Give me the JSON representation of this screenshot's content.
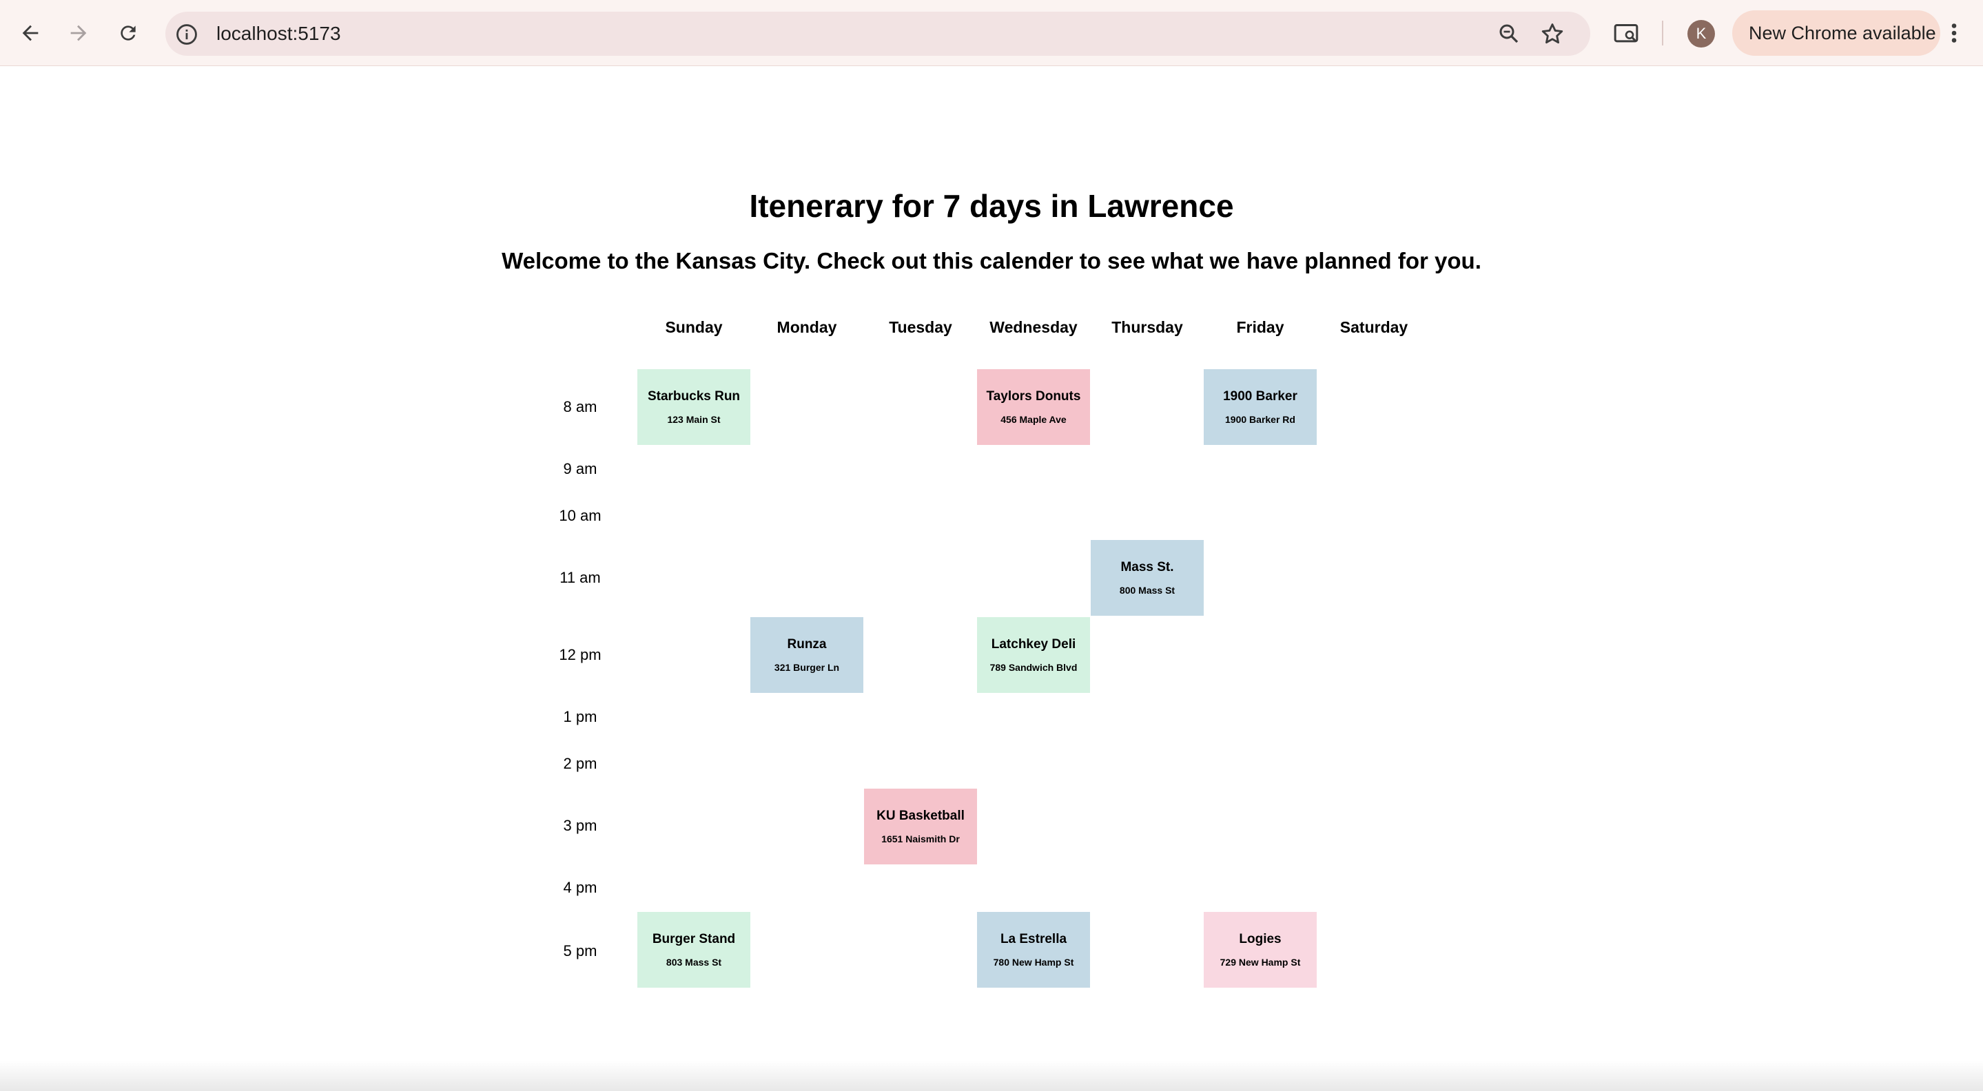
{
  "browser": {
    "url": "localhost:5173",
    "profile_initial": "K",
    "update_label": "New Chrome available",
    "icons": [
      "back-icon",
      "forward-icon",
      "reload-icon",
      "info-icon",
      "zoom-icon",
      "star-icon",
      "cast-icon",
      "more-icon"
    ]
  },
  "page": {
    "title": "Itenerary for 7 days in Lawrence",
    "subtitle": "Welcome to the Kansas City. Check out this calender to see what we have planned for you."
  },
  "days": [
    "Sunday",
    "Monday",
    "Tuesday",
    "Wednesday",
    "Thursday",
    "Friday",
    "Saturday"
  ],
  "times": [
    "8 am",
    "9 am",
    "10 am",
    "11 am",
    "12 pm",
    "1 pm",
    "2 pm",
    "3 pm",
    "4 pm",
    "5 pm"
  ],
  "events": [
    {
      "name": "Starbucks Run",
      "address": "123 Main St",
      "day": "Sunday",
      "time": "8 am",
      "color": "#d4f2e1"
    },
    {
      "name": "Taylors Donuts",
      "address": "456 Maple Ave",
      "day": "Wednesday",
      "time": "8 am",
      "color": "#f5c3cb"
    },
    {
      "name": "1900 Barker",
      "address": "1900 Barker Rd",
      "day": "Friday",
      "time": "8 am",
      "color": "#c3d9e5"
    },
    {
      "name": "Mass St.",
      "address": "800 Mass St",
      "day": "Thursday",
      "time": "11 am",
      "color": "#c3d9e5"
    },
    {
      "name": "Runza",
      "address": "321 Burger Ln",
      "day": "Monday",
      "time": "12 pm",
      "color": "#c3d9e5"
    },
    {
      "name": "Latchkey Deli",
      "address": "789 Sandwich Blvd",
      "day": "Wednesday",
      "time": "12 pm",
      "color": "#d4f2e1"
    },
    {
      "name": "KU Basketball",
      "address": "1651 Naismith Dr",
      "day": "Tuesday",
      "time": "3 pm",
      "color": "#f5c3cb"
    },
    {
      "name": "Burger Stand",
      "address": "803 Mass St",
      "day": "Sunday",
      "time": "5 pm",
      "color": "#d4f2e1"
    },
    {
      "name": "La Estrella",
      "address": "780 New Hamp St",
      "day": "Wednesday",
      "time": "5 pm",
      "color": "#c3d9e5"
    },
    {
      "name": "Logies",
      "address": "729 New Hamp St",
      "day": "Friday",
      "time": "5 pm",
      "color": "#f9d8e1"
    }
  ]
}
